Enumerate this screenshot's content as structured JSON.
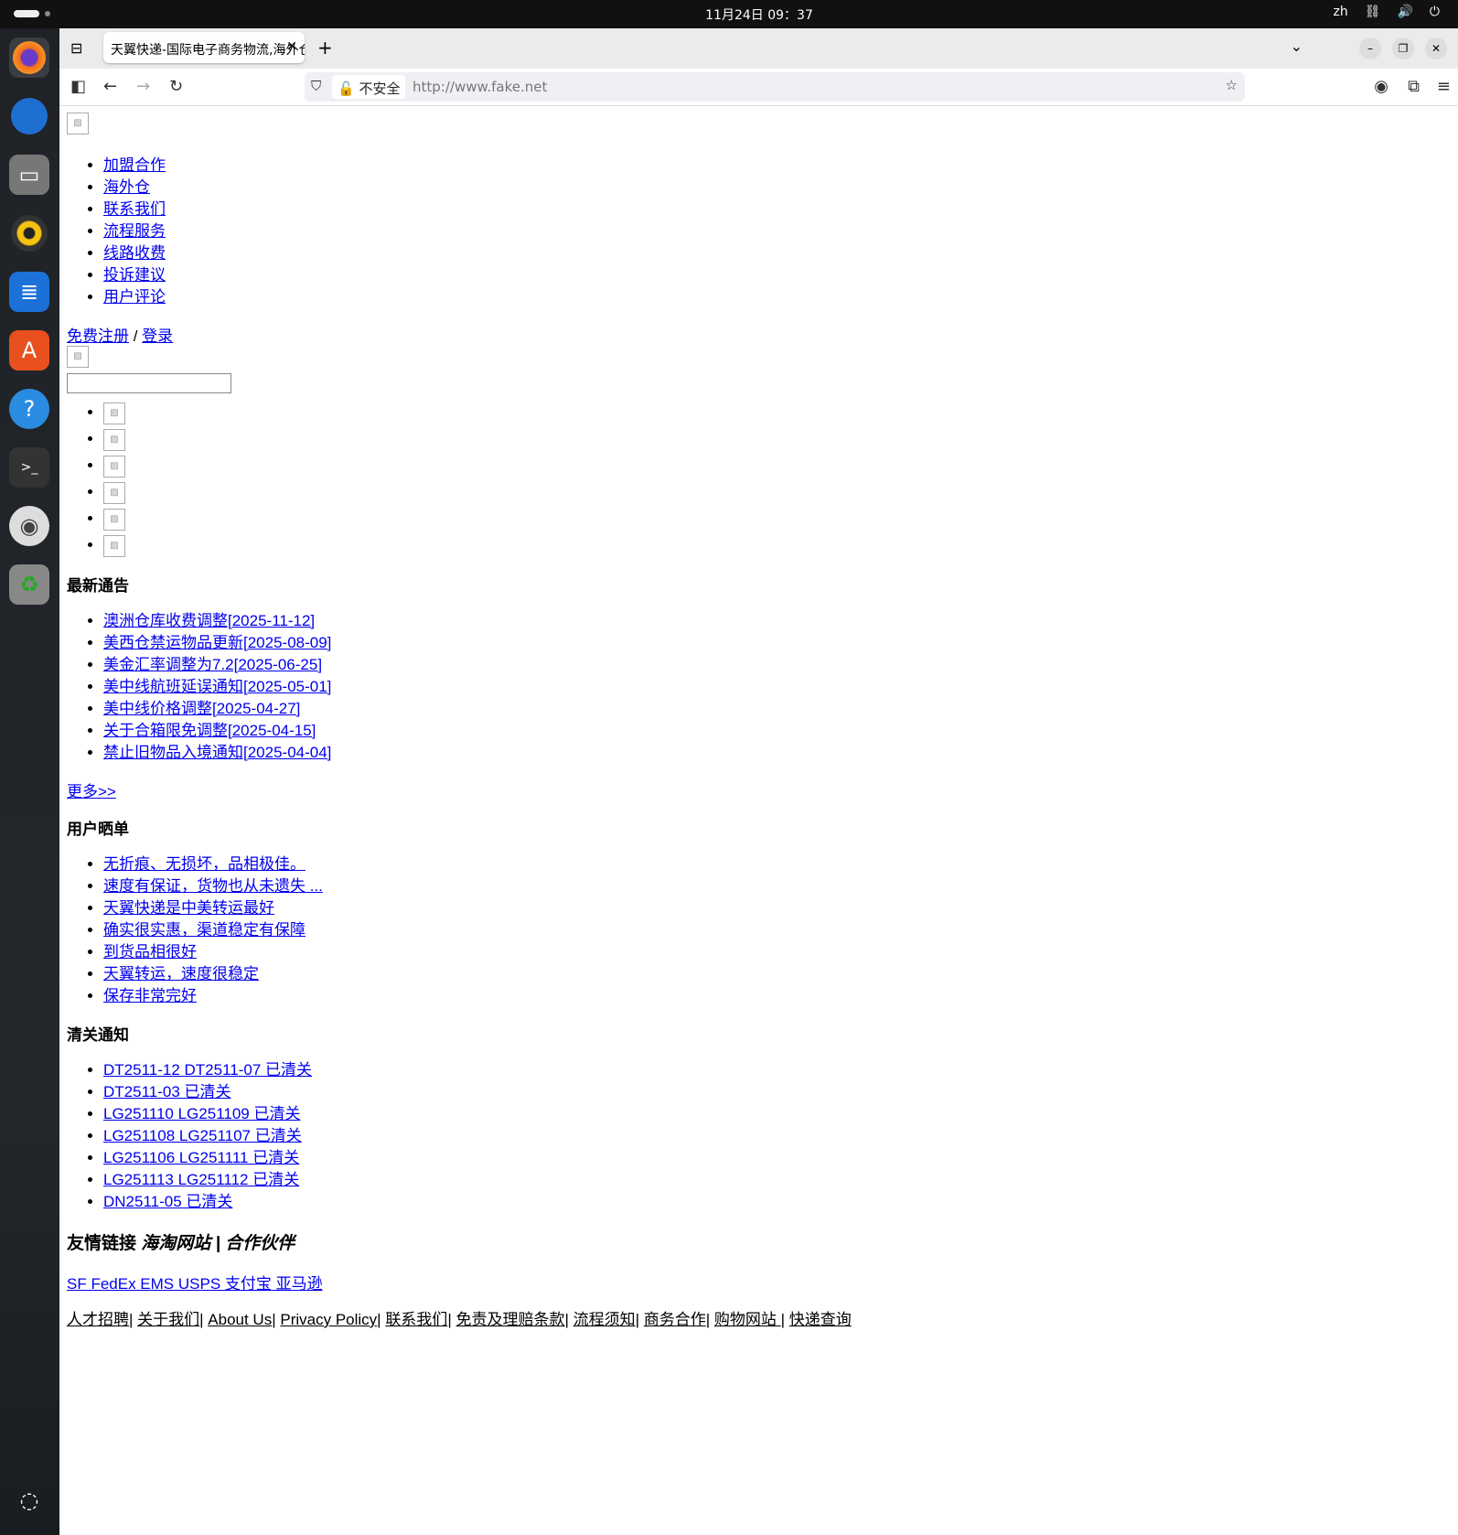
{
  "system": {
    "clock": "11月24日 09：37",
    "lang": "zh"
  },
  "browser": {
    "tab_title": "天翼快递-国际电子商务物流,海外仓",
    "security_label": "不安全",
    "url": "http://www.fake.net"
  },
  "nav": [
    "加盟合作",
    "海外仓",
    "联系我们",
    "流程服务",
    "线路收费",
    "投诉建议",
    "用户评论"
  ],
  "auth": {
    "register": " 免费注册",
    "sep": " / ",
    "login": "登录"
  },
  "search": {
    "value": ""
  },
  "notices": {
    "title": "最新通告",
    "items": [
      "澳洲仓库收费调整[2025-11-12]",
      "美西仓禁运物品更新[2025-08-09]",
      "美金汇率调整为7.2[2025-06-25]",
      "美中线航班延误通知[2025-05-01]",
      "美中线价格调整[2025-04-27]",
      "关于合箱限免调整[2025-04-15]",
      "禁止旧物品入境通知[2025-04-04]"
    ],
    "more": "更多>>"
  },
  "reviews": {
    "title": "用户晒单",
    "items": [
      "无折痕、无损坏，品相极佳。",
      "速度有保证，货物也从未遗失 ...",
      "天翼快递是中美转运最好",
      "确实很实惠，渠道稳定有保障",
      "到货品相很好",
      "天翼转运，速度很稳定",
      "保存非常完好"
    ]
  },
  "customs": {
    "title": "清关通知",
    "items": [
      "DT2511-12 DT2511-07 已清关",
      "DT2511-03 已清关",
      "LG251110 LG251109 已清关",
      "LG251108 LG251107 已清关",
      "LG251106 LG251111 已清关",
      "LG251113 LG251112 已清关",
      "DN2511-05 已清关"
    ]
  },
  "links": {
    "title": "友情链接",
    "title_italic": "海淘网站 | 合作伙伴",
    "partners": "SF FedEx EMS USPS 支付宝 亚马逊"
  },
  "footer": [
    "人才招聘",
    "关于我们",
    "About Us",
    "Privacy Policy",
    "联系我们",
    "免责及理赔条款",
    "流程须知",
    "商务合作",
    "购物网站 ",
    "快递查询"
  ]
}
